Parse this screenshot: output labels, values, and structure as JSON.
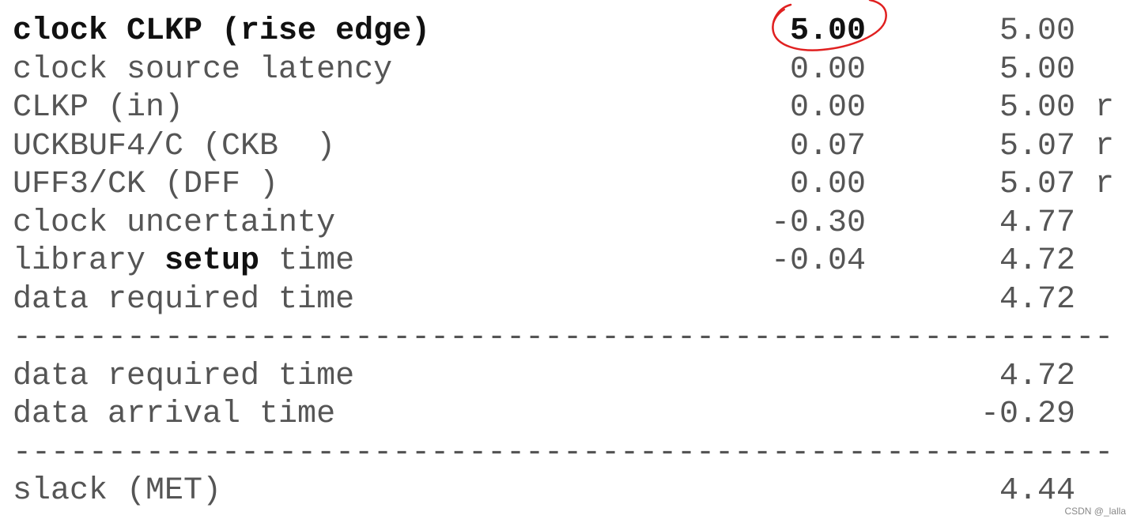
{
  "rows": [
    {
      "label": "clock CLKP (rise edge)",
      "incr": "5.00",
      "path": "5.00",
      "flag": "",
      "bold": true
    },
    {
      "label": "clock source latency",
      "incr": "0.00",
      "path": "5.00",
      "flag": ""
    },
    {
      "label": "CLKP (in)",
      "incr": "0.00",
      "path": "5.00",
      "flag": "r"
    },
    {
      "label": "UCKBUF4/C (CKB  )",
      "incr": "0.07",
      "path": "5.07",
      "flag": "r"
    },
    {
      "label": "UFF3/CK (DFF )",
      "incr": "0.00",
      "path": "5.07",
      "flag": "r"
    },
    {
      "label": "clock uncertainty",
      "incr": "-0.30",
      "path": "4.77",
      "flag": ""
    },
    {
      "label_pre": "library ",
      "label_bold": "setup",
      "label_post": " time",
      "incr": "-0.04",
      "path": "4.72",
      "flag": ""
    },
    {
      "label": "data required time",
      "incr": "",
      "path": "4.72",
      "flag": ""
    },
    {
      "separator": "----------------------------------------------------------"
    },
    {
      "label": "data required time",
      "incr": "",
      "path": "4.72",
      "flag": ""
    },
    {
      "label": "data arrival time",
      "incr": "",
      "path": "-0.29",
      "flag": ""
    },
    {
      "separator": "----------------------------------------------------------"
    },
    {
      "label": "slack (MET)",
      "incr": "",
      "path": "4.44",
      "flag": ""
    }
  ],
  "annotation": {
    "type": "hand-drawn circle",
    "target": "5.00",
    "color": "#e02020"
  },
  "watermark": "CSDN @_lalla"
}
